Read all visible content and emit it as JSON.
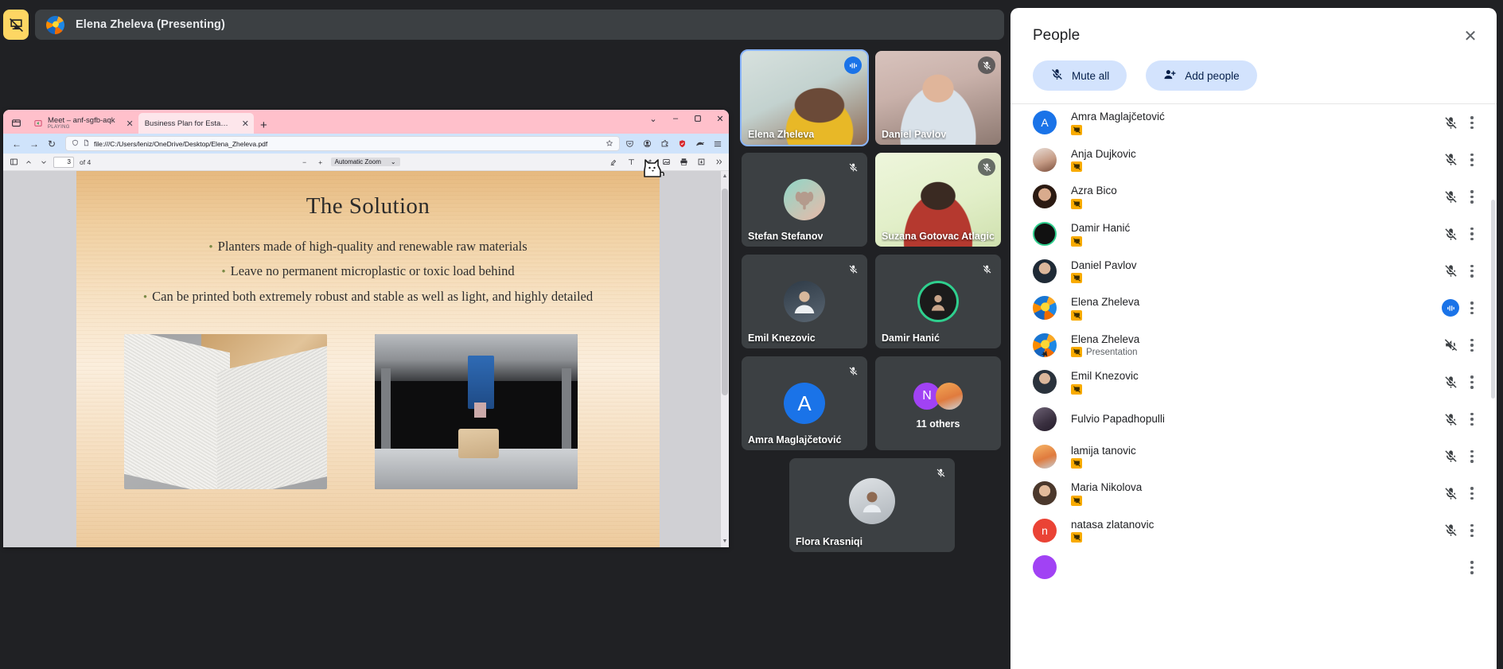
{
  "meeting": {
    "presenting_badge_icon": "present-stop-icon",
    "presenter_label": "Elena Zheleva (Presenting)"
  },
  "browser": {
    "list_all_tabs_icon": "list-all-tabs-icon",
    "tabs": [
      {
        "title": "Meet – anf-sgfb-aqk",
        "sub": "PLAYING",
        "favicon": "meet-audio-icon",
        "active": false
      },
      {
        "title": "Business Plan for Establishment of a",
        "sub": "",
        "favicon": "pdf-icon",
        "active": true
      }
    ],
    "new_tab_label": "+",
    "window_controls": {
      "chevron": "⌄",
      "minimize": "–",
      "maximize": "❐",
      "close": "✕"
    },
    "nav": {
      "back": "←",
      "forward": "→",
      "reload": "↻"
    },
    "url": "file:///C:/Users/leniz/OneDrive/Desktop/Elena_Zheleva.pdf",
    "url_shield_icon": "shield-icon",
    "url_page_icon": "document-icon",
    "bookmark_icon": "star-icon",
    "toolbar_icons": [
      "pocket-icon",
      "account-icon",
      "extension-icon",
      "shield-protection-icon",
      "private-window-icon",
      "hamburger-menu-icon"
    ]
  },
  "pdf_viewer": {
    "sidebar_toggle_icon": "sidebar-toggle-icon",
    "prev_page_icon": "chevron-up-icon",
    "next_page_icon": "chevron-down-icon",
    "page_number": "3",
    "page_total": "of 4",
    "zoom_out_label": "−",
    "zoom_in_label": "+",
    "zoom_level": "Automatic Zoom",
    "zoom_caret": "⌄",
    "right_tools": [
      "highlight-icon",
      "text-icon",
      "draw-icon",
      "image-icon",
      "print-icon",
      "save-icon",
      "more-tools-icon"
    ],
    "scroll_up_arrow": "▲",
    "scroll_down_arrow": "▼"
  },
  "slide": {
    "title": "The Solution",
    "bullets": [
      "Planters made of high-quality and renewable raw materials",
      "Leave no permanent microplastic or toxic load behind",
      "Can be printed both extremely robust and stable as well as light, and highly detailed"
    ],
    "images": [
      "planter-corner-photo",
      "3d-printer-photo"
    ]
  },
  "cursor": {
    "type": "cat-cursor"
  },
  "tiles": [
    {
      "name": "Elena Zheleva",
      "speaking": true,
      "muted": false,
      "kind": "video",
      "avatar_bg": "#c7d6d2",
      "initial": ""
    },
    {
      "name": "Daniel Pavlov",
      "speaking": false,
      "muted": true,
      "kind": "video",
      "avatar_bg": "#cfb9b4",
      "initial": ""
    },
    {
      "name": "Stefan Stefanov",
      "speaking": false,
      "muted": true,
      "kind": "avatar",
      "avatar_bg": "#7ec8bd",
      "initial": ""
    },
    {
      "name": "Suzana Gotovac Atlagic",
      "speaking": false,
      "muted": true,
      "kind": "video",
      "avatar_bg": "#e4efd4",
      "initial": ""
    },
    {
      "name": "Emil Knezovic",
      "speaking": false,
      "muted": true,
      "kind": "avatar",
      "avatar_bg": "#3d4a57",
      "initial": ""
    },
    {
      "name": "Damir Hanić",
      "speaking": false,
      "muted": true,
      "kind": "avatar",
      "avatar_bg": "#2aa46f",
      "initial": ""
    },
    {
      "name": "Amra Maglajčetović",
      "speaking": false,
      "muted": true,
      "kind": "initial",
      "avatar_bg": "#1a73e8",
      "initial": "A"
    },
    {
      "name": "11 others",
      "speaking": false,
      "muted": false,
      "kind": "others",
      "avatar_bg": "#a142f4",
      "initial": "N"
    },
    {
      "name": "Flora Krasniqi",
      "speaking": false,
      "muted": true,
      "kind": "avatar",
      "avatar_bg": "#6b7077",
      "initial": ""
    }
  ],
  "people_panel": {
    "title": "People",
    "close_icon": "close-icon",
    "mute_all": {
      "label": "Mute all",
      "icon": "mic-off-icon"
    },
    "add_people": {
      "label": "Add people",
      "icon": "person-add-icon"
    },
    "participants": [
      {
        "name": "Amra Maglajčetović",
        "sub": "",
        "badge": true,
        "status": "muted",
        "avatar_type": "initial",
        "initial": "A",
        "color": "#1a73e8",
        "pinned": false
      },
      {
        "name": "Anja Dujkovic",
        "sub": "",
        "badge": true,
        "status": "muted",
        "avatar_type": "photo",
        "initial": "",
        "color": "#c9a18c",
        "pinned": false
      },
      {
        "name": "Azra Bico",
        "sub": "",
        "badge": true,
        "status": "muted",
        "avatar_type": "photo",
        "initial": "",
        "color": "#4a3128",
        "pinned": false
      },
      {
        "name": "Damir Hanić",
        "sub": "",
        "badge": true,
        "status": "muted",
        "avatar_type": "photo",
        "initial": "",
        "color": "#2aa46f",
        "pinned": false
      },
      {
        "name": "Daniel Pavlov",
        "sub": "",
        "badge": true,
        "status": "muted",
        "avatar_type": "photo",
        "initial": "",
        "color": "#2b3a4a",
        "pinned": false
      },
      {
        "name": "Elena Zheleva",
        "sub": "",
        "badge": true,
        "status": "speaking",
        "avatar_type": "photo",
        "initial": "",
        "color": "#1e88e5",
        "pinned": false
      },
      {
        "name": "Elena Zheleva",
        "sub": "Presentation",
        "badge": true,
        "status": "speaker-off",
        "avatar_type": "photo",
        "initial": "",
        "color": "#1e88e5",
        "pinned": true
      },
      {
        "name": "Emil Knezovic",
        "sub": "",
        "badge": true,
        "status": "muted",
        "avatar_type": "photo",
        "initial": "",
        "color": "#3d4a57",
        "pinned": false
      },
      {
        "name": "Fulvio Papadhopulli",
        "sub": "",
        "badge": false,
        "status": "muted",
        "avatar_type": "photo",
        "initial": "",
        "color": "#453b4e",
        "pinned": false
      },
      {
        "name": "lamija tanovic",
        "sub": "",
        "badge": true,
        "status": "muted",
        "avatar_type": "photo",
        "initial": "",
        "color": "#e8913f",
        "pinned": false
      },
      {
        "name": "Maria Nikolova",
        "sub": "",
        "badge": true,
        "status": "muted",
        "avatar_type": "photo",
        "initial": "",
        "color": "#6d5348",
        "pinned": false
      },
      {
        "name": "natasa zlatanovic",
        "sub": "",
        "badge": true,
        "status": "muted",
        "avatar_type": "initial",
        "initial": "n",
        "color": "#ea4335",
        "pinned": false
      },
      {
        "name": "",
        "sub": "",
        "badge": false,
        "status": "muted",
        "avatar_type": "initial",
        "initial": "",
        "color": "#a142f4",
        "pinned": false
      }
    ]
  },
  "colors": {
    "meet_bg": "#202124",
    "tile_bg": "#3c4043",
    "accent_blue": "#1a73e8",
    "speaking_border": "#8ab4f8",
    "chip_blue": "#d3e3fd",
    "badge_yellow": "#f9ab00",
    "firefox_tabstrip": "#ffc0cb",
    "firefox_navbar": "#cfe3fb"
  }
}
